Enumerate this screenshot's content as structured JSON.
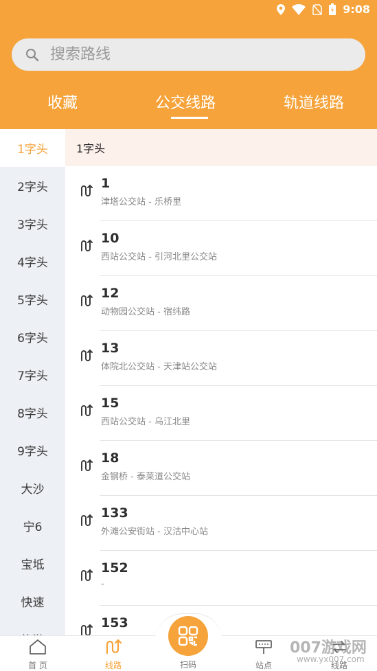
{
  "status_bar": {
    "time": "9:08"
  },
  "search": {
    "placeholder": "搜索路线"
  },
  "tabs": [
    {
      "label": "收藏"
    },
    {
      "label": "公交线路",
      "active": true
    },
    {
      "label": "轨道线路"
    }
  ],
  "sidebar": {
    "items": [
      {
        "label": "1字头",
        "active": true
      },
      {
        "label": "2字头"
      },
      {
        "label": "3字头"
      },
      {
        "label": "4字头"
      },
      {
        "label": "5字头"
      },
      {
        "label": "6字头"
      },
      {
        "label": "7字头"
      },
      {
        "label": "8字头"
      },
      {
        "label": "9字头"
      },
      {
        "label": "大沙"
      },
      {
        "label": "宁6"
      },
      {
        "label": "宝坻"
      },
      {
        "label": "快速"
      },
      {
        "label": "旅游"
      }
    ]
  },
  "section": {
    "title": "1字头"
  },
  "routes": [
    {
      "number": "1",
      "stops": "津塔公交站 - 乐桥里"
    },
    {
      "number": "10",
      "stops": "西站公交站 - 引河北里公交站"
    },
    {
      "number": "12",
      "stops": "动物园公交站 - 宿纬路"
    },
    {
      "number": "13",
      "stops": "体院北公交站 - 天津站公交站"
    },
    {
      "number": "15",
      "stops": "西站公交站 - 乌江北里"
    },
    {
      "number": "18",
      "stops": "金钢桥 - 泰莱道公交站"
    },
    {
      "number": "133",
      "stops": "外滩公安街站 - 汉沽中心站"
    },
    {
      "number": "152",
      "stops": "-"
    },
    {
      "number": "153",
      "stops": ""
    }
  ],
  "bottom_nav": {
    "home": "首 页",
    "routes": "线路",
    "scan": "扫码",
    "stations": "站点",
    "transfer": "线路"
  },
  "watermark": {
    "main": "007游戏网",
    "sub": "www.yx007.com"
  },
  "colors": {
    "accent": "#f5a33a",
    "sidebar_bg": "#edf0f4",
    "section_bg": "#fdf1ec"
  }
}
